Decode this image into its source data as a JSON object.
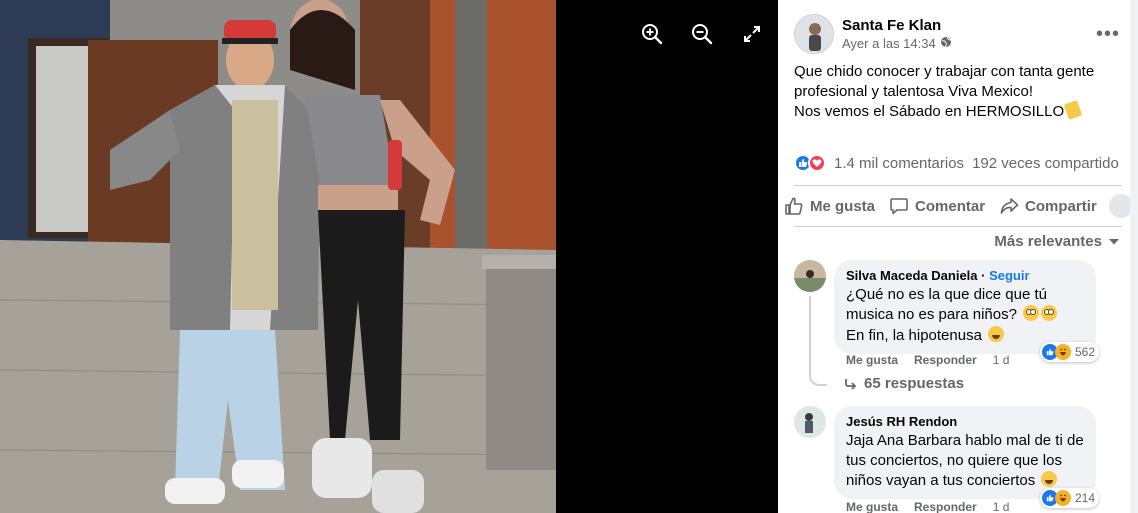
{
  "viewer": {
    "tools": [
      "zoom-in-icon",
      "zoom-out-icon",
      "fullscreen-icon"
    ]
  },
  "post": {
    "author": "Santa Fe Klan",
    "time": "Ayer a las 14:34",
    "text_line1": "Que chido conocer y trabajar con tanta gente profesional y talentosa Viva Mexico!",
    "text_line2": "Nos vemos el Sábado en HERMOSILLO",
    "comments_count": "1.4 mil comentarios",
    "shares_count": "192 veces compartido"
  },
  "actions": {
    "like": "Me gusta",
    "comment": "Comentar",
    "share": "Compartir"
  },
  "sort_label": "Más relevantes",
  "comments": [
    {
      "author": "Silva Maceda Daniela",
      "follow": "Seguir",
      "text1": "¿Qué no es la que dice que tú musica no es para niños?",
      "text2": "En fin, la hipotenusa",
      "like": "Me gusta",
      "reply": "Responder",
      "time": "1 d",
      "reactions": "562",
      "replies": "65 respuestas"
    },
    {
      "author": "Jesús RH Rendon",
      "text1": "Jaja Ana Barbara hablo mal de ti de tus conciertos, no quiere que los niños vayan a tus conciertos",
      "like": "Me gusta",
      "reply": "Responder",
      "time": "1 d",
      "reactions": "214"
    }
  ],
  "colors": {
    "accent": "#1877f2",
    "love": "#f33e58",
    "secondary_text": "#65676b",
    "bubble": "#f0f2f5"
  }
}
